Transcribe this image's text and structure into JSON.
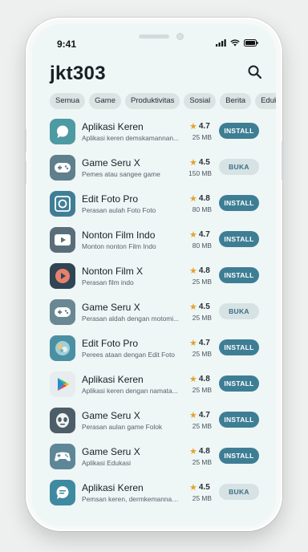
{
  "status_bar": {
    "time": "9:41"
  },
  "header": {
    "title": "jkt303"
  },
  "categories": [
    "Semua",
    "Game",
    "Produktivitas",
    "Sosial",
    "Berita",
    "Edukasi"
  ],
  "apps": [
    {
      "name": "Aplikasi Keren",
      "desc": "Aplikasi keren demskamannan...",
      "rating": "4.7",
      "size": "25 MB",
      "action": "INSTALL",
      "icon": "chat-bubble-icon",
      "icon_bg": "#4d9aa2"
    },
    {
      "name": "Game Seru X",
      "desc": "Pemes atau sangee game",
      "rating": "4.5",
      "size": "150 MB",
      "action": "BUKA",
      "icon": "gamepad-icon",
      "icon_bg": "#607f8c"
    },
    {
      "name": "Edit Foto Pro",
      "desc": "Perasan aulah Foto Foto",
      "rating": "4.8",
      "size": "80 MB",
      "action": "INSTALL",
      "icon": "photo-frame-icon",
      "icon_bg": "#3f7f96"
    },
    {
      "name": "Nonton Film Indo",
      "desc": "Monton nonton Film Indo",
      "rating": "4.7",
      "size": "80 MB",
      "action": "INSTALL",
      "icon": "video-play-icon",
      "icon_bg": "#5a6e7a"
    },
    {
      "name": "Nonton Film X",
      "desc": "Perasan film indo",
      "rating": "4.8",
      "size": "25 MB",
      "action": "INSTALL",
      "icon": "play-circle-icon",
      "icon_bg": "#2f4554"
    },
    {
      "name": "Game Seru X",
      "desc": "Perasan aldah dengan motomi...",
      "rating": "4.5",
      "size": "25 MB",
      "action": "BUKA",
      "icon": "gamepad-icon",
      "icon_bg": "#6a8794"
    },
    {
      "name": "Edit Foto Pro",
      "desc": "Perees ataan dengan Edit Foto",
      "rating": "4.7",
      "size": "25 MB",
      "action": "INSTALL",
      "icon": "photo-globe-icon",
      "icon_bg": "#4b8fa3"
    },
    {
      "name": "Aplikasi Keren",
      "desc": "Aplikasi keren dengan namata...",
      "rating": "4.8",
      "size": "25 MB",
      "action": "INSTALL",
      "icon": "play-store-icon",
      "icon_bg": "#e7ecee"
    },
    {
      "name": "Game Seru X",
      "desc": "Perasan aulan game Folok",
      "rating": "4.7",
      "size": "25 MB",
      "action": "INSTALL",
      "icon": "alien-face-icon",
      "icon_bg": "#4e5e68"
    },
    {
      "name": "Game Seru X",
      "desc": "Aplikasi Edukasi",
      "rating": "4.8",
      "size": "25 MB",
      "action": "INSTALL",
      "icon": "game-controller-icon",
      "icon_bg": "#5d8796"
    },
    {
      "name": "Aplikasi Keren",
      "desc": "Pemsan keren, dermkemannann...",
      "rating": "4.5",
      "size": "25 MB",
      "action": "BUKA",
      "icon": "message-icon",
      "icon_bg": "#3f8aa0"
    }
  ],
  "colors": {
    "primary": "#3e7e95",
    "secondary": "#d6e2e4",
    "star": "#e2a32b",
    "background": "#eef6f6"
  }
}
